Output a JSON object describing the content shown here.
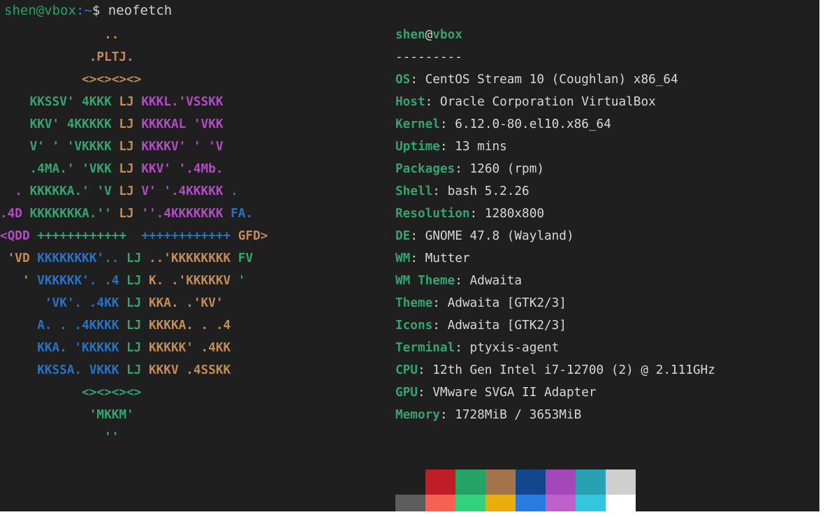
{
  "prompt": {
    "user_host": "shen@vbox",
    "path": ":~",
    "symbol": "$ ",
    "command": "neofetch"
  },
  "logo": [
    [
      {
        "t": "              ..",
        "c": "orange"
      }
    ],
    [
      {
        "t": "            .PLTJ.",
        "c": "orange"
      }
    ],
    [
      {
        "t": "           <><><><>",
        "c": "orange"
      }
    ],
    [
      {
        "t": "    KKSSV' 4KKK ",
        "c": "green"
      },
      {
        "t": "LJ",
        "c": "orange"
      },
      {
        "t": " KKKL.'VSSKK",
        "c": "purple"
      }
    ],
    [
      {
        "t": "    KKV' 4KKKKK ",
        "c": "green"
      },
      {
        "t": "LJ",
        "c": "orange"
      },
      {
        "t": " KKKKAL 'VKK",
        "c": "purple"
      }
    ],
    [
      {
        "t": "    V' ' 'VKKKK ",
        "c": "green"
      },
      {
        "t": "LJ",
        "c": "orange"
      },
      {
        "t": " KKKKV' ' 'V",
        "c": "purple"
      }
    ],
    [
      {
        "t": "    .4MA.' 'VKK ",
        "c": "green"
      },
      {
        "t": "LJ",
        "c": "orange"
      },
      {
        "t": " KKV' '.4Mb.",
        "c": "purple"
      }
    ],
    [
      {
        "t": "  . ",
        "c": "purple"
      },
      {
        "t": "KKKKKA.' 'V ",
        "c": "green"
      },
      {
        "t": "LJ",
        "c": "orange"
      },
      {
        "t": " V' '.4KKKKK ",
        "c": "purple"
      },
      {
        "t": ".",
        "c": "blue"
      }
    ],
    [
      {
        "t": ".4D ",
        "c": "purple"
      },
      {
        "t": "KKKKKKKA.'' ",
        "c": "green"
      },
      {
        "t": "LJ",
        "c": "orange"
      },
      {
        "t": " ''.4KKKKKKK ",
        "c": "purple"
      },
      {
        "t": "FA.",
        "c": "blue"
      }
    ],
    [
      {
        "t": "<QDD ",
        "c": "purple"
      },
      {
        "t": "++++++++++++  ",
        "c": "green"
      },
      {
        "t": "++++++++++++ ",
        "c": "blue"
      },
      {
        "t": "GFD>",
        "c": "orange"
      }
    ],
    [
      {
        "t": " 'VD ",
        "c": "orange"
      },
      {
        "t": "KKKKKKKK'.. ",
        "c": "blue"
      },
      {
        "t": "LJ",
        "c": "green"
      },
      {
        "t": " ..'KKKKKKKK ",
        "c": "orange"
      },
      {
        "t": "FV",
        "c": "green"
      }
    ],
    [
      {
        "t": "   ' ",
        "c": "orange"
      },
      {
        "t": "VKKKKK'. .4 ",
        "c": "blue"
      },
      {
        "t": "LJ",
        "c": "green"
      },
      {
        "t": " K. .'KKKKKV ",
        "c": "orange"
      },
      {
        "t": "'",
        "c": "green"
      }
    ],
    [
      {
        "t": "      'VK'. .4KK ",
        "c": "blue"
      },
      {
        "t": "LJ",
        "c": "green"
      },
      {
        "t": " KKA. .'KV'",
        "c": "orange"
      }
    ],
    [
      {
        "t": "     A. . .4KKKK ",
        "c": "blue"
      },
      {
        "t": "LJ",
        "c": "green"
      },
      {
        "t": " KKKKA. . .4",
        "c": "orange"
      }
    ],
    [
      {
        "t": "     KKA. 'KKKKK ",
        "c": "blue"
      },
      {
        "t": "LJ",
        "c": "green"
      },
      {
        "t": " KKKKK' .4KK",
        "c": "orange"
      }
    ],
    [
      {
        "t": "     KKSSA. VKKK ",
        "c": "blue"
      },
      {
        "t": "LJ",
        "c": "green"
      },
      {
        "t": " KKKV .4SSKK",
        "c": "orange"
      }
    ],
    [
      {
        "t": "           <><><><>",
        "c": "green"
      }
    ],
    [
      {
        "t": "            'MKKM'",
        "c": "green"
      }
    ],
    [
      {
        "t": "              ''",
        "c": "green"
      }
    ]
  ],
  "info": {
    "title_user": "shen",
    "title_at": "@",
    "title_host": "vbox",
    "separator": "---------",
    "rows": [
      {
        "key": "OS",
        "value": "CentOS Stream 10 (Coughlan) x86_64"
      },
      {
        "key": "Host",
        "value": "Oracle Corporation VirtualBox"
      },
      {
        "key": "Kernel",
        "value": "6.12.0-80.el10.x86_64"
      },
      {
        "key": "Uptime",
        "value": "13 mins"
      },
      {
        "key": "Packages",
        "value": "1260 (rpm)"
      },
      {
        "key": "Shell",
        "value": "bash 5.2.26"
      },
      {
        "key": "Resolution",
        "value": "1280x800"
      },
      {
        "key": "DE",
        "value": "GNOME 47.8 (Wayland)"
      },
      {
        "key": "WM",
        "value": "Mutter"
      },
      {
        "key": "WM Theme",
        "value": "Adwaita"
      },
      {
        "key": "Theme",
        "value": "Adwaita [GTK2/3]"
      },
      {
        "key": "Icons",
        "value": "Adwaita [GTK2/3]"
      },
      {
        "key": "Terminal",
        "value": "ptyxis-agent"
      },
      {
        "key": "CPU",
        "value": "12th Gen Intel i7-12700 (2) @ 2.111GHz"
      },
      {
        "key": "GPU",
        "value": "VMware SVGA II Adapter"
      },
      {
        "key": "Memory",
        "value": "1728MiB / 3653MiB"
      }
    ]
  },
  "palette": {
    "normal": [
      "#1f1f1f",
      "#c01c28",
      "#26a269",
      "#a2734c",
      "#12488b",
      "#a347ba",
      "#2aa1b3",
      "#cfcfcf"
    ],
    "bright": [
      "#5d5d5d",
      "#f66151",
      "#33d17a",
      "#e9ad0c",
      "#2a7bde",
      "#c061cb",
      "#33c7de",
      "#ffffff"
    ]
  }
}
